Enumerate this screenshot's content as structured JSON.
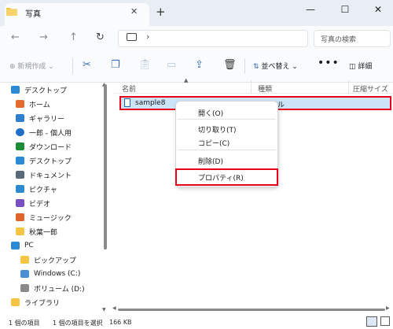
{
  "window": {
    "tab_title": "写真",
    "tab_close": "✕",
    "new_tab": "+",
    "minimize": "—",
    "maximize": "☐",
    "close": "✕"
  },
  "nav": {
    "back": "←",
    "forward": "→",
    "up": "↑",
    "refresh": "↻",
    "address_chevron": "›",
    "search_placeholder": "写真の検索"
  },
  "toolbar": {
    "new_label": "新規作成",
    "sort_label": "並べ替え",
    "more_label": "•••",
    "details_label": "詳細",
    "icons": [
      "cut-icon",
      "copy-icon",
      "paste-icon",
      "rename-icon",
      "share-icon",
      "delete-icon"
    ]
  },
  "sidebar": {
    "items": [
      {
        "label": "デスクトップ",
        "icon": "desktop-icon",
        "color": "#2a8ad6"
      },
      {
        "label": "ホーム",
        "icon": "home-icon",
        "color": "#e46b2b"
      },
      {
        "label": "ギャラリー",
        "icon": "gallery-icon",
        "color": "#2f7fcf"
      },
      {
        "label": "一郎 - 個人用",
        "icon": "onedrive-icon",
        "color": "#1e6fc8"
      },
      {
        "label": "ダウンロード",
        "icon": "download-icon",
        "color": "#1e8d3a"
      },
      {
        "label": "デスクトップ",
        "icon": "desktop-icon",
        "color": "#2a8ad6"
      },
      {
        "label": "ドキュメント",
        "icon": "documents-icon",
        "color": "#5b6a7a"
      },
      {
        "label": "ピクチャ",
        "icon": "pictures-icon",
        "color": "#2b8bd0"
      },
      {
        "label": "ビデオ",
        "icon": "videos-icon",
        "color": "#7a4fc4"
      },
      {
        "label": "ミュージック",
        "icon": "music-icon",
        "color": "#e0632a"
      },
      {
        "label": "秋葉一郎",
        "icon": "folder-icon",
        "color": "#f5c443"
      },
      {
        "label": "PC",
        "icon": "pc-icon",
        "color": "#2a8ad6"
      },
      {
        "label": "ピックアップ",
        "icon": "folder-icon",
        "color": "#f5c443"
      },
      {
        "label": "Windows (C:)",
        "icon": "drive-icon",
        "color": "#4a8fd6"
      },
      {
        "label": "ボリューム (D:)",
        "icon": "drive-icon",
        "color": "#8a8a8a"
      },
      {
        "label": "ライブラリ",
        "icon": "library-icon",
        "color": "#f5c443"
      }
    ]
  },
  "files": {
    "columns": [
      "名前",
      "種類",
      "圧縮サイズ"
    ],
    "rows": [
      {
        "name": "sample8",
        "type": "ァイル"
      }
    ]
  },
  "context_menu": {
    "open": "開く(O)",
    "cut": "切り取り(T)",
    "copy": "コピー(C)",
    "delete": "削除(D)",
    "properties": "プロパティ(R)"
  },
  "status": {
    "item_count": "1 個の項目",
    "selected": "1 個の項目を選択",
    "size": "166 KB"
  },
  "colors": {
    "highlight": "#e8001c",
    "selection": "#cce4f7",
    "accent": "#1f67b6"
  }
}
